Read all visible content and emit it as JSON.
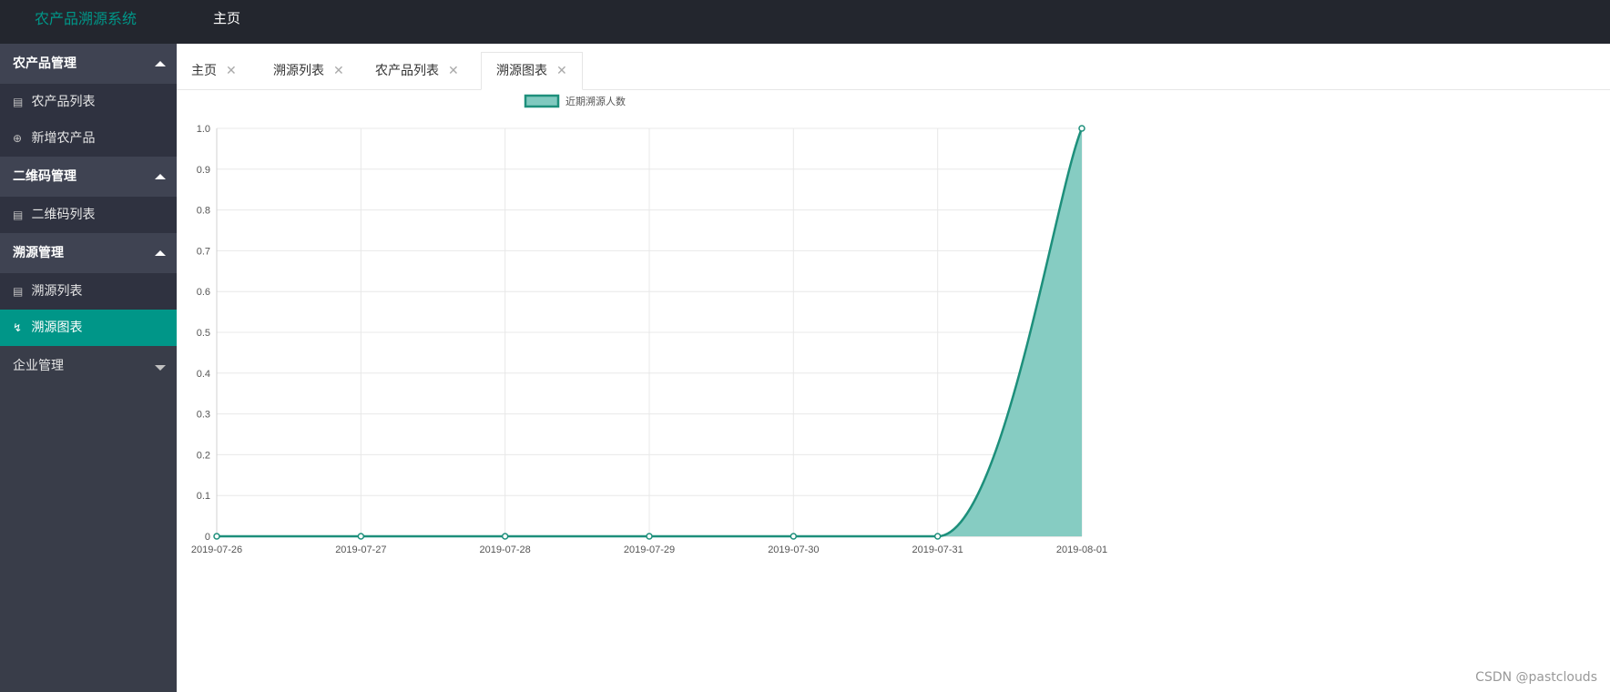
{
  "app": {
    "logo": "农产品溯源系统",
    "top_nav": "主页"
  },
  "sidebar": {
    "groups": [
      {
        "label": "农产品管理",
        "items": [
          {
            "label": "农产品列表",
            "icon": "doc-icon"
          },
          {
            "label": "新增农产品",
            "icon": "plus-circle-icon"
          }
        ]
      },
      {
        "label": "二维码管理",
        "items": [
          {
            "label": "二维码列表",
            "icon": "doc-icon"
          }
        ]
      },
      {
        "label": "溯源管理",
        "items": [
          {
            "label": "溯源列表",
            "icon": "doc-icon"
          },
          {
            "label": "溯源图表",
            "icon": "pulse-icon",
            "active": true
          }
        ]
      },
      {
        "label": "企业管理",
        "items": []
      }
    ]
  },
  "tabs": [
    {
      "label": "主页"
    },
    {
      "label": "溯源列表"
    },
    {
      "label": "农产品列表"
    },
    {
      "label": "溯源图表",
      "active": true
    }
  ],
  "chart_data": {
    "type": "area",
    "x": [
      "2019-07-26",
      "2019-07-27",
      "2019-07-28",
      "2019-07-29",
      "2019-07-30",
      "2019-07-31",
      "2019-08-01"
    ],
    "series": [
      {
        "name": "近期溯源人数",
        "values": [
          0,
          0,
          0,
          0,
          0,
          0,
          1
        ]
      }
    ],
    "yticks": [
      "0",
      "0.1",
      "0.2",
      "0.3",
      "0.4",
      "0.5",
      "0.6",
      "0.7",
      "0.8",
      "0.9",
      "1.0"
    ],
    "ylim": [
      0,
      1
    ],
    "grid": true,
    "legend": "top",
    "colors": {
      "line": "#1d8f7b",
      "fill": "#80c9bf"
    }
  },
  "watermark": "CSDN @pastclouds"
}
